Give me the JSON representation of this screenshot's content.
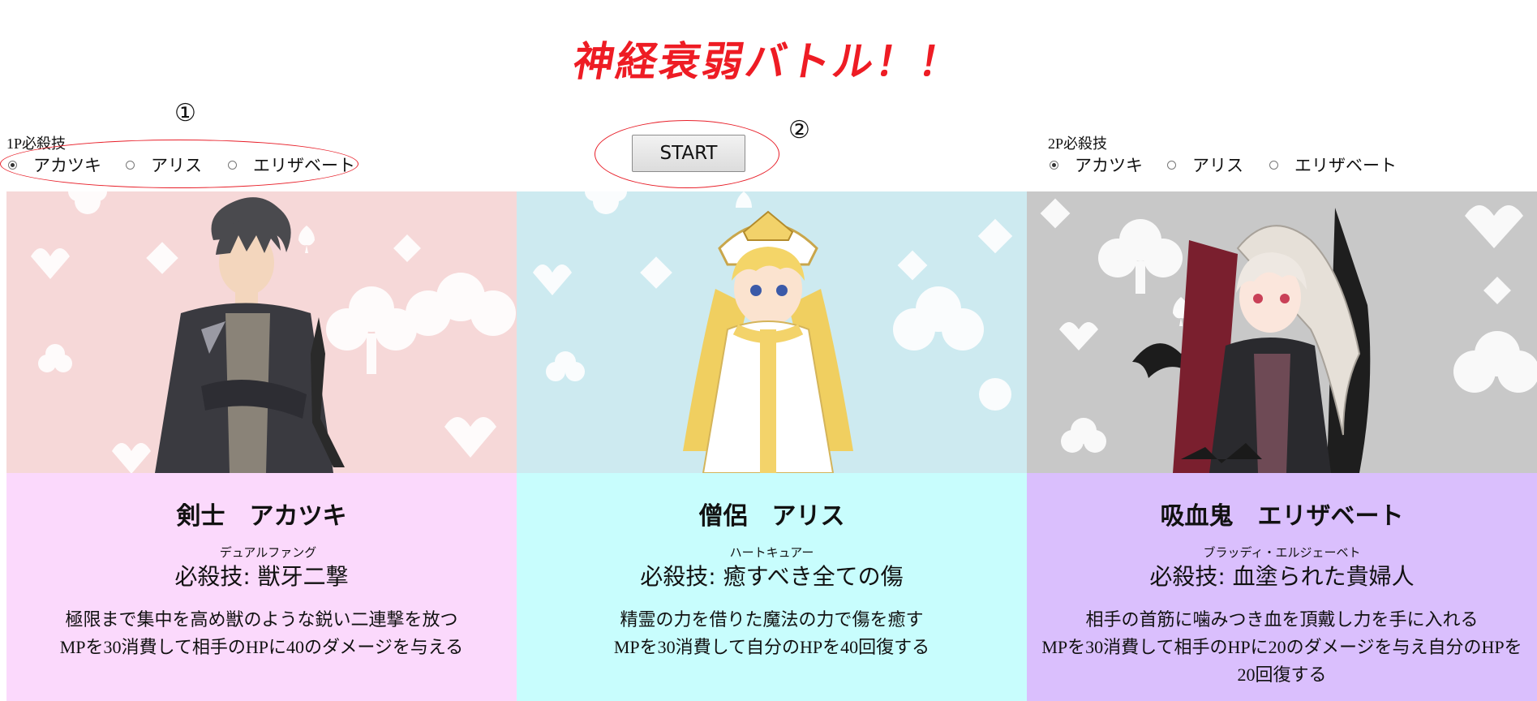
{
  "title": "神経衰弱バトル！！",
  "markers": {
    "one": "①",
    "two": "②"
  },
  "controls": {
    "p1": {
      "label": "1P必殺技",
      "options": [
        "アカツキ",
        "アリス",
        "エリザベート"
      ],
      "selected": "アカツキ"
    },
    "p2": {
      "label": "2P必殺技",
      "options": [
        "アカツキ",
        "アリス",
        "エリザベート"
      ],
      "selected": "アカツキ"
    },
    "start_label": "START"
  },
  "colors": {
    "title": "#ee1c24",
    "annotation": "#e8202a",
    "card1_art_bg": "#f6d8d8",
    "card1_info_bg": "#fbd9fc",
    "card2_art_bg": "#cdeaf0",
    "card2_info_bg": "#c8fdfd",
    "card3_art_bg": "#c8c8c8",
    "card3_info_bg": "#dabffd"
  },
  "characters": [
    {
      "name": "剣士　アカツキ",
      "skill_ruby": "デュアルファング",
      "skill": "必殺技: 獣牙二撃",
      "desc": [
        "極限まで集中を高め獣のような鋭い二連撃を放つ",
        "MPを30消費して相手のHPに40のダメージを与える"
      ],
      "icon": "swordsman-portrait"
    },
    {
      "name": "僧侶　アリス",
      "skill_ruby": "ハートキュアー",
      "skill": "必殺技: 癒すべき全ての傷",
      "desc": [
        "精霊の力を借りた魔法の力で傷を癒す",
        "MPを30消費して自分のHPを40回復する"
      ],
      "icon": "priest-portrait"
    },
    {
      "name": "吸血鬼　エリザベート",
      "skill_ruby": "ブラッディ・エルジェーベト",
      "skill": "必殺技: 血塗られた貴婦人",
      "desc": [
        "相手の首筋に噛みつき血を頂戴し力を手に入れる",
        "MPを30消費して相手のHPに20のダメージを与え自分のHPを20回復する"
      ],
      "icon": "vampire-portrait"
    }
  ]
}
